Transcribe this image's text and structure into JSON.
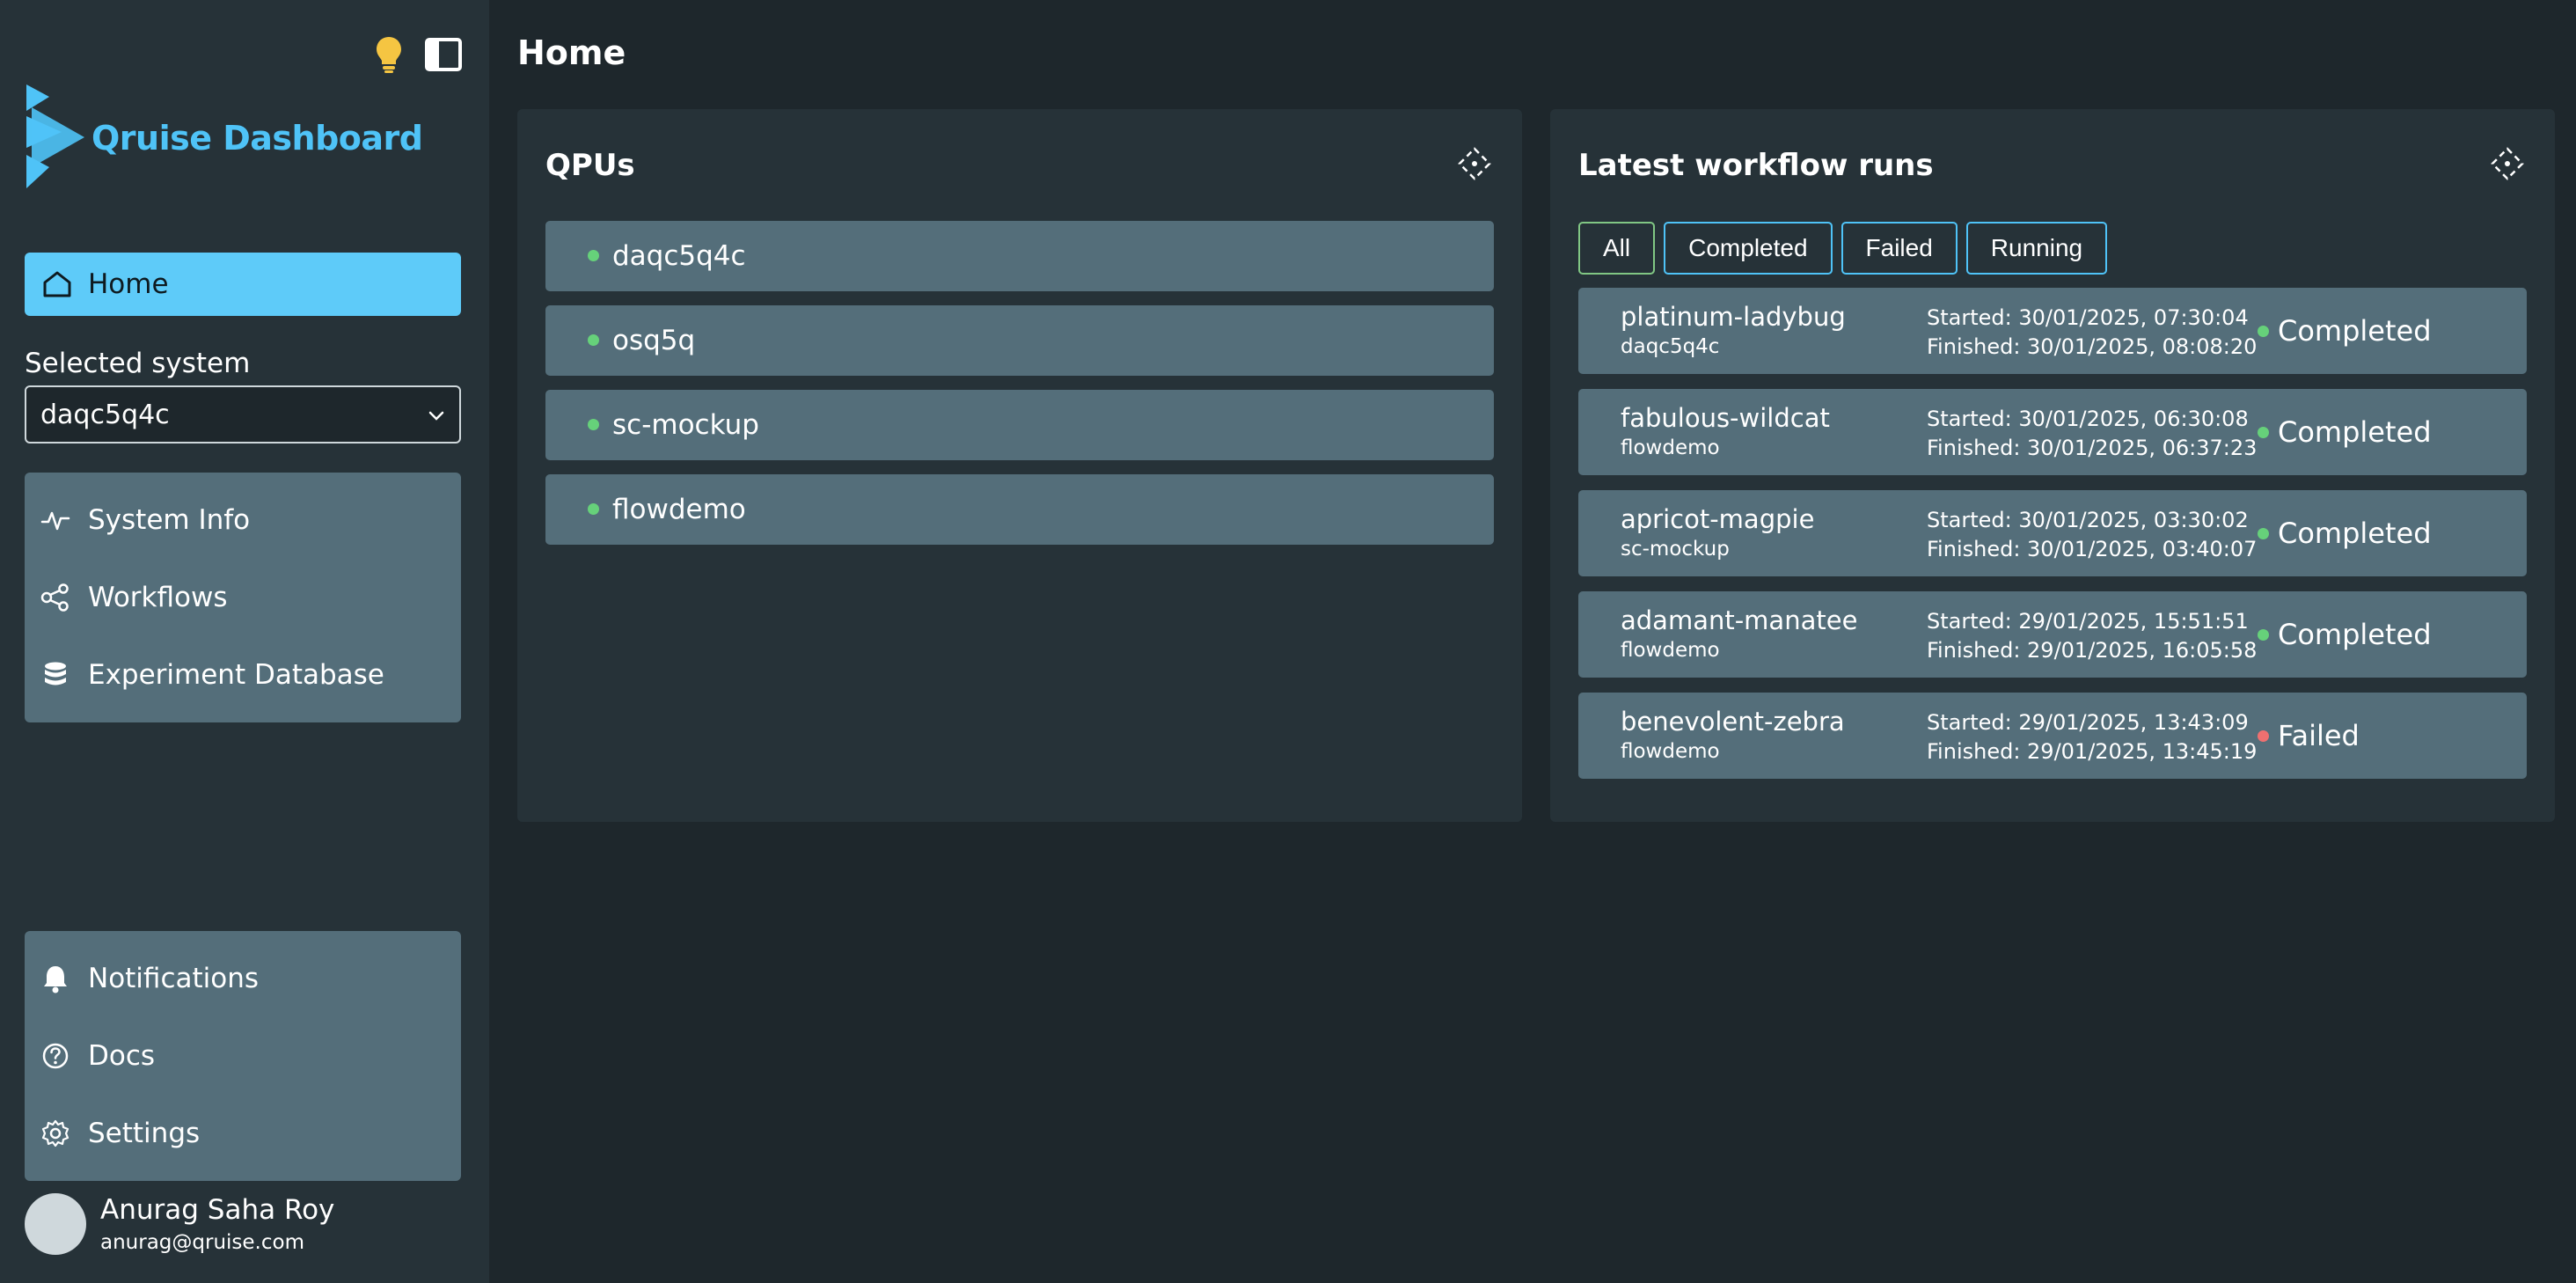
{
  "sidebar": {
    "brand": "Qruise Dashboard",
    "home_label": "Home",
    "selected_system_label": "Selected system",
    "selected_system_value": "daqc5q4c",
    "nav_items": [
      {
        "label": "System Info",
        "icon": "activity-icon"
      },
      {
        "label": "Workflows",
        "icon": "workflow-icon"
      },
      {
        "label": "Experiment Database",
        "icon": "database-icon"
      }
    ],
    "bottom_items": [
      {
        "label": "Notifications",
        "icon": "bell-icon"
      },
      {
        "label": "Docs",
        "icon": "help-circle-icon"
      },
      {
        "label": "Settings",
        "icon": "gear-icon"
      }
    ],
    "user": {
      "name": "Anurag Saha Roy",
      "email": "anurag@qruise.com"
    }
  },
  "page": {
    "title": "Home"
  },
  "qpus": {
    "title": "QPUs",
    "items": [
      "daqc5q4c",
      "osq5q",
      "sc-mockup",
      "flowdemo"
    ]
  },
  "workflow_runs": {
    "title": "Latest workflow runs",
    "filters": [
      "All",
      "Completed",
      "Failed",
      "Running"
    ],
    "active_filter": "All",
    "runs": [
      {
        "name": "platinum-ladybug",
        "system": "daqc5q4c",
        "started": "Started: 30/01/2025, 07:30:04",
        "finished": "Finished: 30/01/2025, 08:08:20",
        "status": "Completed"
      },
      {
        "name": "fabulous-wildcat",
        "system": "flowdemo",
        "started": "Started: 30/01/2025, 06:30:08",
        "finished": "Finished: 30/01/2025, 06:37:23",
        "status": "Completed"
      },
      {
        "name": "apricot-magpie",
        "system": "sc-mockup",
        "started": "Started: 30/01/2025, 03:30:02",
        "finished": "Finished: 30/01/2025, 03:40:07",
        "status": "Completed"
      },
      {
        "name": "adamant-manatee",
        "system": "flowdemo",
        "started": "Started: 29/01/2025, 15:51:51",
        "finished": "Finished: 29/01/2025, 16:05:58",
        "status": "Completed"
      },
      {
        "name": "benevolent-zebra",
        "system": "flowdemo",
        "started": "Started: 29/01/2025, 13:43:09",
        "finished": "Finished: 29/01/2025, 13:45:19",
        "status": "Failed"
      }
    ]
  },
  "colors": {
    "accent": "#5ecbf9",
    "success": "#66d17a",
    "failure": "#ef7070",
    "idea": "#f5c542"
  }
}
